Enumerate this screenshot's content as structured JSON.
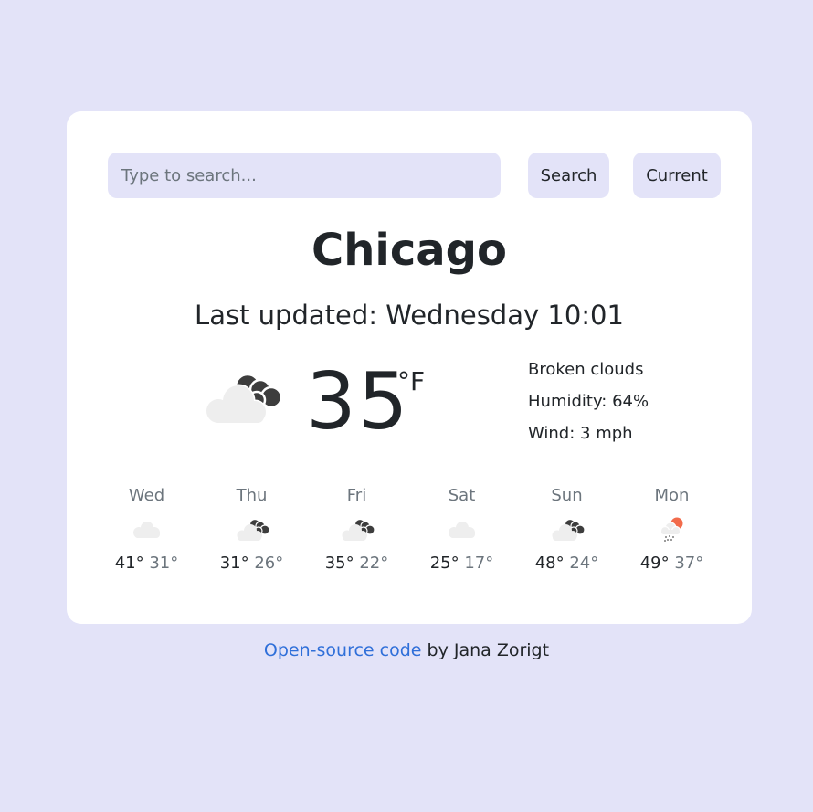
{
  "search": {
    "placeholder": "Type to search...",
    "value": "",
    "search_label": "Search",
    "current_label": "Current"
  },
  "weather": {
    "city": "Chicago",
    "updated": "Last updated: Wednesday 10:01",
    "temperature": "35",
    "unit": "°F",
    "icon": "broken-clouds-icon",
    "description": "Broken clouds",
    "humidity": "Humidity: 64%",
    "wind": "Wind: 3 mph"
  },
  "forecast": [
    {
      "day": "Wed",
      "max": "41°",
      "min": "31°",
      "icon": "few-clouds-icon"
    },
    {
      "day": "Thu",
      "max": "31°",
      "min": "26°",
      "icon": "broken-clouds-icon"
    },
    {
      "day": "Fri",
      "max": "35°",
      "min": "22°",
      "icon": "broken-clouds-icon"
    },
    {
      "day": "Sat",
      "max": "25°",
      "min": "17°",
      "icon": "few-clouds-icon"
    },
    {
      "day": "Sun",
      "max": "48°",
      "min": "24°",
      "icon": "broken-clouds-icon"
    },
    {
      "day": "Mon",
      "max": "49°",
      "min": "37°",
      "icon": "rain-sun-icon"
    }
  ],
  "footer": {
    "link_text": "Open-source code",
    "suffix": " by Jana Zorigt"
  },
  "colors": {
    "background": "#e3e3f8",
    "card": "#ffffff",
    "link": "#2f6fd9",
    "cloud_light": "#eeeeee",
    "cloud_dark": "#3d3d3d",
    "sun": "#f26b4b"
  }
}
